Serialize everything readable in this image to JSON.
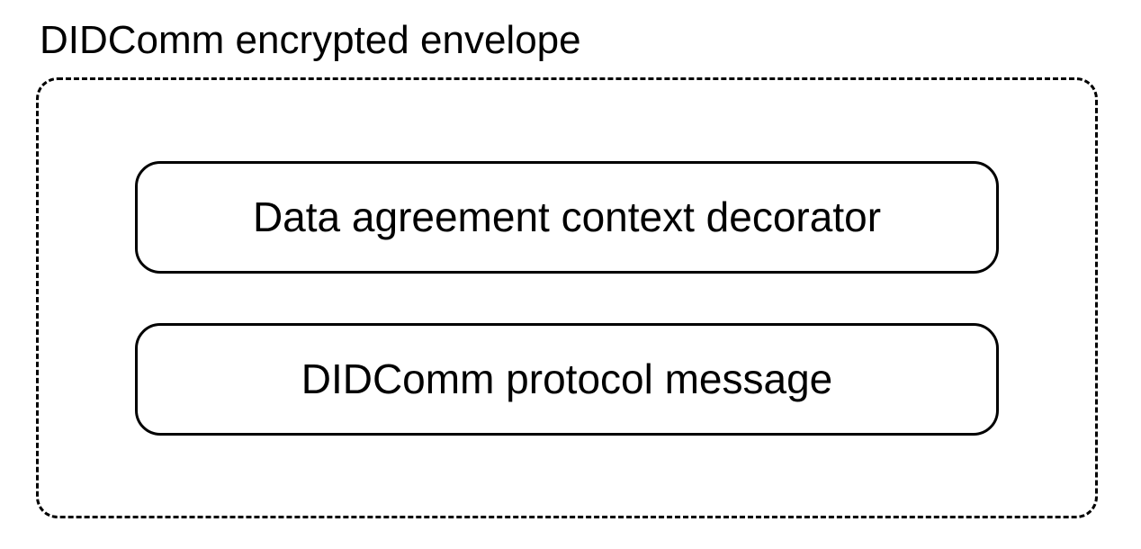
{
  "envelope": {
    "title": "DIDComm encrypted envelope",
    "items": [
      {
        "label": "Data agreement context decorator"
      },
      {
        "label": "DIDComm protocol message"
      }
    ]
  }
}
